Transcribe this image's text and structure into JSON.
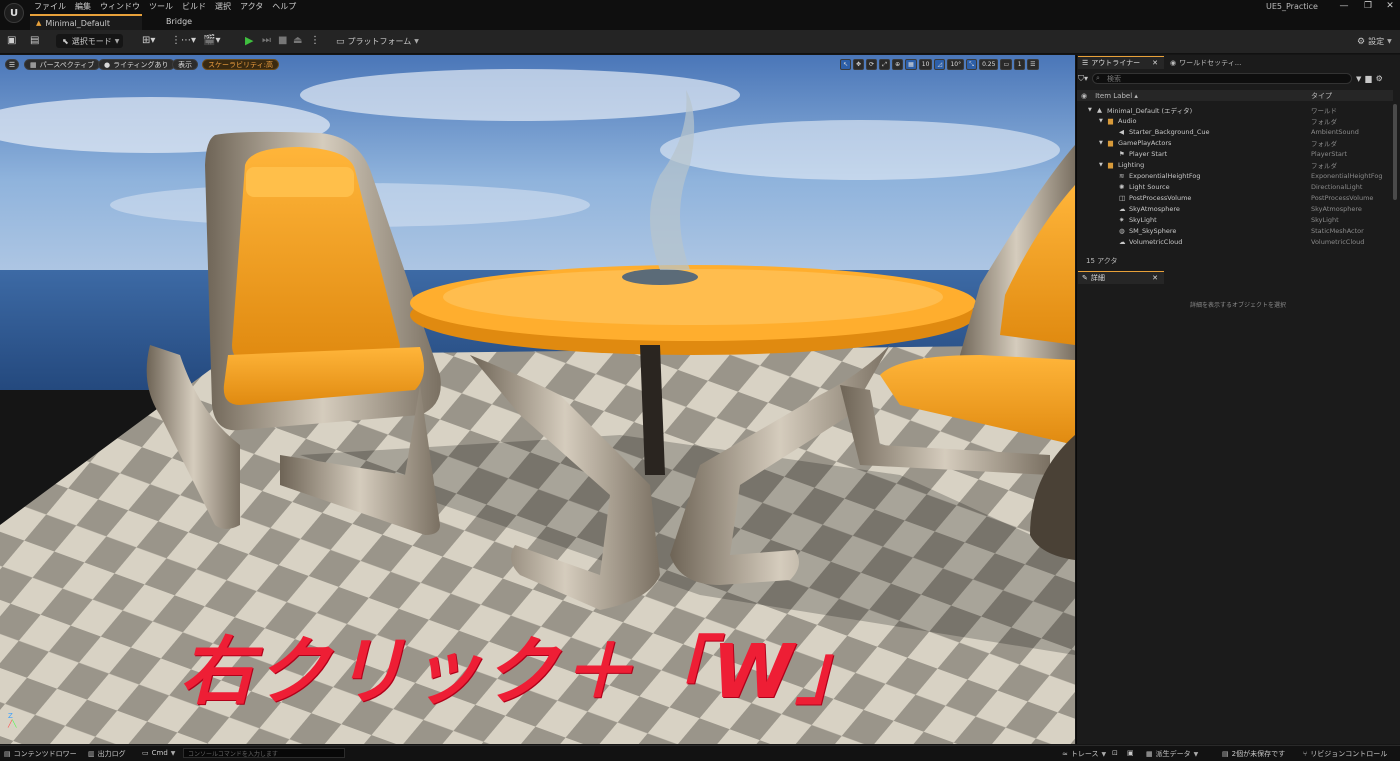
{
  "menu": [
    "ファイル",
    "編集",
    "ウィンドウ",
    "ツール",
    "ビルド",
    "選択",
    "アクタ",
    "ヘルプ"
  ],
  "project_name": "UE5_Practice",
  "window_controls": [
    "—",
    "❐",
    "✕"
  ],
  "tabs": {
    "level": "Minimal_Default",
    "bridge": "Bridge"
  },
  "toolbar": {
    "mode_label": "選択モード",
    "platform_label": "プラットフォーム",
    "settings_label": "設定"
  },
  "viewport": {
    "pills": [
      "パースペクティブ",
      "ライティングあり",
      "表示",
      "スケーラビリティ:高"
    ],
    "tools": [
      "↖",
      "✥",
      "⟳",
      "⤢",
      "⊕",
      "▦",
      "10",
      "◿",
      "10°",
      "⤡",
      "0.25",
      "▭",
      "1",
      "☰"
    ],
    "overlay_text": "右クリック＋「W」"
  },
  "outliner": {
    "tab_label": "アウトライナー",
    "world_tab_label": "ワールドセッティ...",
    "search_placeholder": "検索",
    "col_label": "Item Label ▴",
    "col_type": "タイプ",
    "count": "15 アクタ",
    "rows": [
      {
        "label": "Minimal_Default (エディタ)",
        "type": "ワールド",
        "indent": 0,
        "icon": "▲"
      },
      {
        "label": "Audio",
        "type": "フォルダ",
        "indent": 1,
        "icon": "▆"
      },
      {
        "label": "Starter_Background_Cue",
        "type": "AmbientSound",
        "indent": 2,
        "icon": "◀"
      },
      {
        "label": "GamePlayActors",
        "type": "フォルダ",
        "indent": 1,
        "icon": "▆"
      },
      {
        "label": "Player Start",
        "type": "PlayerStart",
        "indent": 2,
        "icon": "⚑"
      },
      {
        "label": "Lighting",
        "type": "フォルダ",
        "indent": 1,
        "icon": "▆"
      },
      {
        "label": "ExponentialHeightFog",
        "type": "ExponentialHeightFog",
        "indent": 2,
        "icon": "≋"
      },
      {
        "label": "Light Source",
        "type": "DirectionalLight",
        "indent": 2,
        "icon": "✺"
      },
      {
        "label": "PostProcessVolume",
        "type": "PostProcessVolume",
        "indent": 2,
        "icon": "◫"
      },
      {
        "label": "SkyAtmosphere",
        "type": "SkyAtmosphere",
        "indent": 2,
        "icon": "☁"
      },
      {
        "label": "SkyLight",
        "type": "SkyLight",
        "indent": 2,
        "icon": "✷"
      },
      {
        "label": "SM_SkySphere",
        "type": "StaticMeshActor",
        "indent": 2,
        "icon": "◍"
      },
      {
        "label": "VolumetricCloud",
        "type": "VolumetricCloud",
        "indent": 2,
        "icon": "☁"
      }
    ]
  },
  "details": {
    "tab_label": "詳細",
    "hint": "詳細を表示するオブジェクトを選択"
  },
  "statusbar": {
    "content_drawer": "コンテンツドロワー",
    "output_log": "出力ログ",
    "cmd": "Cmd",
    "console_placeholder": "コンソールコマンドを入力します",
    "trace": "トレース",
    "derived_data": "派生データ",
    "unsaved": "2個が未保存です",
    "revision": "リビジョンコントロール"
  },
  "colors": {
    "accent": "#e8a13a",
    "play": "#3fbf3f",
    "overlay_text": "#ee1e35",
    "selected_tool": "#2d5fa8"
  }
}
